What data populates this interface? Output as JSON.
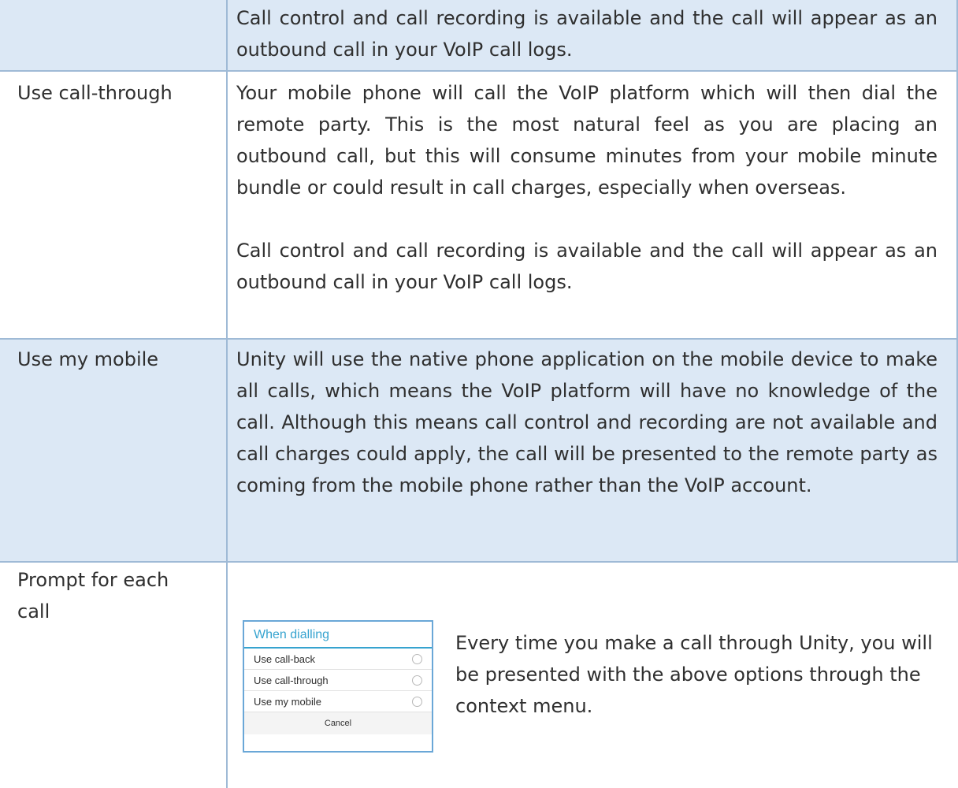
{
  "rows": {
    "row1": {
      "label": "",
      "description": "Call control and call recording is available and the call will appear as an outbound call in your VoIP call logs."
    },
    "row2": {
      "label": "Use call-through",
      "description_p1": "Your mobile phone will call the VoIP platform which will then dial the remote party. This is the most natural feel as you are placing an outbound call, but this will consume minutes from your mobile minute bundle or could result in call charges, especially when overseas.",
      "description_p2": "Call control and call recording is available and the call will appear as an outbound call in your VoIP call logs."
    },
    "row3": {
      "label": "Use my mobile",
      "description": "Unity will use the native phone application on the mobile device to make all calls, which means the VoIP platform will have no knowledge of the call. Although this means call control and recording are not available and call charges could apply, the call will be presented to the remote party as coming from the mobile phone rather than the VoIP account."
    },
    "row4": {
      "label": "Prompt for each call",
      "description": "Every time you make a call through Unity, you will be presented with the above options through the context menu."
    }
  },
  "dialog": {
    "title": "When dialling",
    "options": [
      "Use call-back",
      "Use call-through",
      "Use my mobile"
    ],
    "cancel_label": "Cancel"
  },
  "colors": {
    "shaded_row": "#dce8f5",
    "border": "#9fbad6",
    "dialog_accent": "#36a3cf"
  }
}
